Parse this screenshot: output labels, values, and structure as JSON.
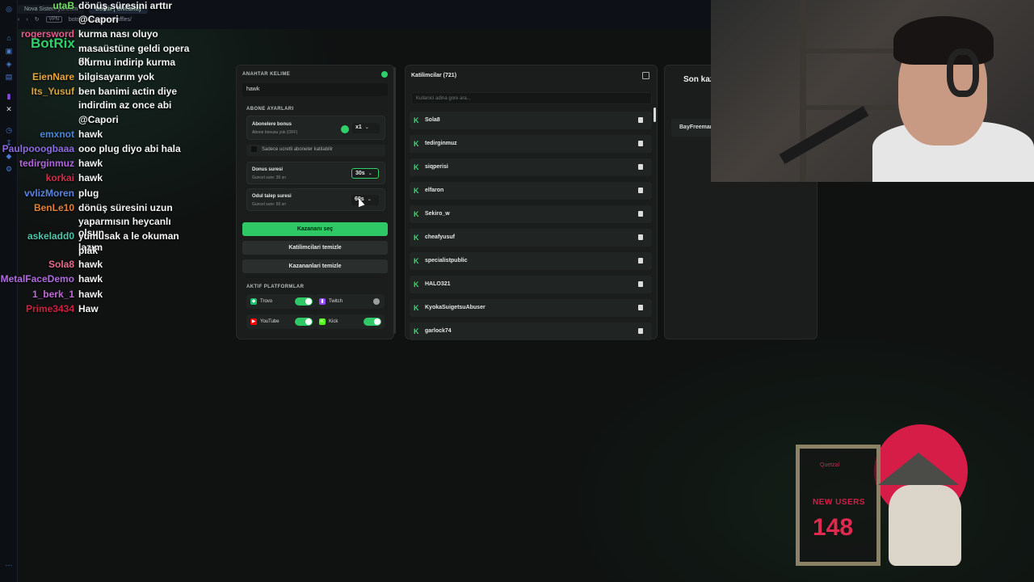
{
  "browser": {
    "tabs": [
      "Nova Sistem yönetim",
      "BotRix | Giveaway"
    ],
    "vpn_label": "VPN",
    "url": "botrix.live/widgets/raffles/"
  },
  "chat": {
    "brand": "BotRix",
    "messages": [
      {
        "user": "utaB",
        "color": "#6fe05f",
        "msg": "dönüş süresini arttır"
      },
      {
        "user": "",
        "color": "#ffffff",
        "msg": "@Capori"
      },
      {
        "user": "rogersword",
        "color": "#e85a8f",
        "msg": "kurma nası oluyo"
      },
      {
        "user": "",
        "color": "#ffffff",
        "msg": "masaüstüne geldi opera gx"
      },
      {
        "user": "",
        "color": "#ffffff",
        "msg": "olurmu indirip kurma"
      },
      {
        "user": "EienNare",
        "color": "#e8a43a",
        "msg": "bilgisayarım yok"
      },
      {
        "user": "Its_Yusuf",
        "color": "#d6a33c",
        "msg": "ben banimi actin diye"
      },
      {
        "user": "",
        "color": "#ffffff",
        "msg": "indirdim az once abi"
      },
      {
        "user": "",
        "color": "#ffffff",
        "msg": "@Capori"
      },
      {
        "user": "emxnot",
        "color": "#4a86d8",
        "msg": "hawk"
      },
      {
        "user": "Paulpooogbaaa",
        "color": "#8c6be0",
        "msg": "ooo plug diyo abi hala"
      },
      {
        "user": "tedirginmuz",
        "color": "#b264e0",
        "msg": "hawk"
      },
      {
        "user": "korkai",
        "color": "#d0304a",
        "msg": "hawk"
      },
      {
        "user": "vvlizMoren",
        "color": "#5a82e0",
        "msg": "plug"
      },
      {
        "user": "BenLe10",
        "color": "#e0803a",
        "msg": "dönüş süresini uzun"
      },
      {
        "user": "",
        "color": "#ffffff",
        "msg": "yaparmısın heycanlı olsun"
      },
      {
        "user": "askeladd0",
        "color": "#4fc4a8",
        "msg": "yumusak a le okuman lazım"
      },
      {
        "user": "",
        "color": "#ffffff",
        "msg": "plâk"
      },
      {
        "user": "Sola8",
        "color": "#e86a8a",
        "msg": "hawk"
      },
      {
        "user": "MetalFaceDemo",
        "color": "#b06ae0",
        "msg": "hawk"
      },
      {
        "user": "1_berk_1",
        "color": "#c06ad8",
        "msg": "hawk"
      },
      {
        "user": "Prime3434",
        "color": "#d02040",
        "msg": "Haw"
      }
    ]
  },
  "settings": {
    "keyword_label": "ANAHTAR KELIME",
    "keyword_value": "hawk",
    "sub_settings_label": "ABONE AYARLARI",
    "sub_bonus_title": "Abonelere bonus",
    "sub_bonus_sub": "Abone bonusu yok (OFF)",
    "sub_bonus_value": "x1",
    "subs_only_label": "Sadece ucretli aboneler katilabilir",
    "spin_duration_title": "Donus suresi",
    "spin_duration_sub": "Guncel sure: 30 sn",
    "spin_duration_value": "30s",
    "claim_duration_title": "Odul talep suresi",
    "claim_duration_sub": "Guncel sure: 60 sn",
    "claim_duration_value": "60s",
    "pick_winner_label": "Kazananı seç",
    "clear_participants_label": "Katilimcilari temizle",
    "clear_winners_label": "Kazananlari temizle",
    "platforms_label": "AKTIF PLATFORMLAR",
    "platforms": [
      {
        "name": "Trovo",
        "on": true,
        "color": "#1dbf6a"
      },
      {
        "name": "Twitch",
        "on": false,
        "color": "#9146ff"
      },
      {
        "name": "YouTube",
        "on": true,
        "color": "#ff0000"
      },
      {
        "name": "Kick",
        "on": true,
        "color": "#53fc18"
      }
    ]
  },
  "participants": {
    "title": "Katilimcilar (721)",
    "search_placeholder": "Kullanici adina gore ara...",
    "list": [
      "Sola8",
      "tedirginmuz",
      "siqperisi",
      "elfaron",
      "Sekiro_w",
      "cheafyusuf",
      "specialistpublic",
      "HALO321",
      "KyokaSuigetsuAbuser",
      "garlock74"
    ]
  },
  "winners": {
    "title": "Son kazananlar",
    "list": [
      "BayFreeman"
    ]
  },
  "widget": {
    "brand": "Quetzal",
    "label": "NEW USERS",
    "count": "148"
  },
  "colors": {
    "accent": "#2ec866",
    "panel": "#1a1d1c",
    "widget_red": "#d51d48"
  }
}
